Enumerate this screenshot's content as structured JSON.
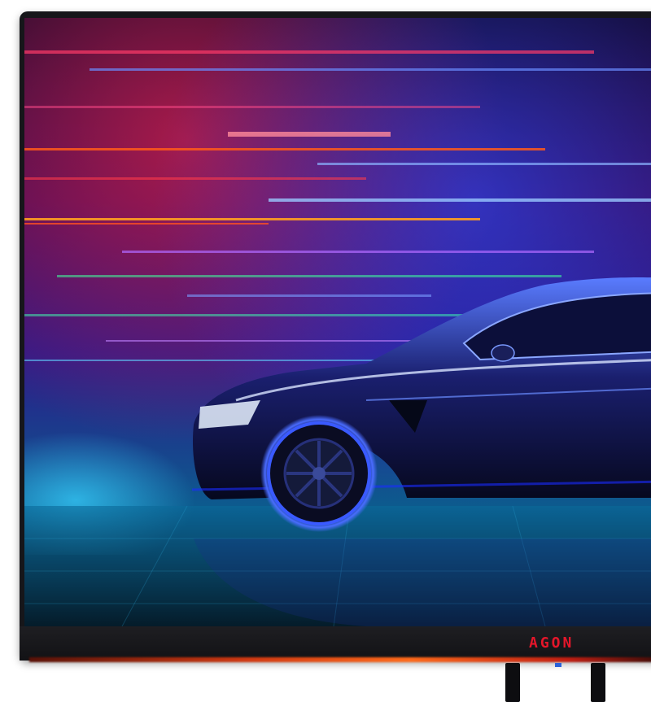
{
  "monitor": {
    "brand_logo": "AGON",
    "brand_color": "#e4162a",
    "screen_content": "sports-car-neon-light-trails"
  }
}
